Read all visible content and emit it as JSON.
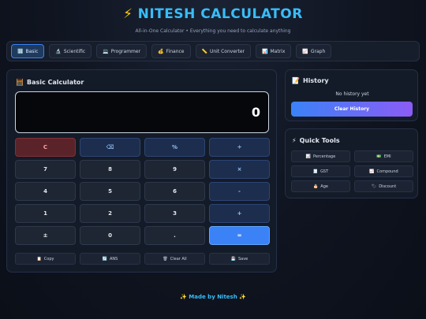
{
  "header": {
    "icon": "⚡",
    "title": "NITESH CALCULATOR",
    "subtitle": "All-in-One Calculator • Everything you need to calculate anything"
  },
  "tabs": [
    {
      "icon": "🔢",
      "label": "Basic",
      "active": true
    },
    {
      "icon": "🔬",
      "label": "Scientific"
    },
    {
      "icon": "💻",
      "label": "Programmer"
    },
    {
      "icon": "💰",
      "label": "Finance"
    },
    {
      "icon": "📏",
      "label": "Unit Converter"
    },
    {
      "icon": "📊",
      "label": "Matrix"
    },
    {
      "icon": "📈",
      "label": "Graph"
    }
  ],
  "calculator": {
    "icon": "🧮",
    "title": "Basic Calculator",
    "display": "0",
    "keys": [
      {
        "label": "C",
        "type": "clear"
      },
      {
        "label": "⌫",
        "type": "op"
      },
      {
        "label": "%",
        "type": "op"
      },
      {
        "label": "÷",
        "type": "op"
      },
      {
        "label": "7"
      },
      {
        "label": "8"
      },
      {
        "label": "9"
      },
      {
        "label": "×",
        "type": "op"
      },
      {
        "label": "4"
      },
      {
        "label": "5"
      },
      {
        "label": "6"
      },
      {
        "label": "-",
        "type": "op"
      },
      {
        "label": "1"
      },
      {
        "label": "2"
      },
      {
        "label": "3"
      },
      {
        "label": "+",
        "type": "op"
      },
      {
        "label": "±"
      },
      {
        "label": "0"
      },
      {
        "label": "."
      },
      {
        "label": "=",
        "type": "equal"
      }
    ],
    "actions": [
      {
        "icon": "📋",
        "label": "Copy"
      },
      {
        "icon": "🔄",
        "label": "ANS"
      },
      {
        "icon": "🗑",
        "label": "Clear All"
      },
      {
        "icon": "💾",
        "label": "Save"
      }
    ]
  },
  "history": {
    "icon": "📝",
    "title": "History",
    "empty_text": "No history yet",
    "clear_label": "Clear History"
  },
  "quick_tools": {
    "icon": "⚡",
    "title": "Quick Tools",
    "items": [
      {
        "icon": "📊",
        "label": "Percentage"
      },
      {
        "icon": "💵",
        "label": "EMI"
      },
      {
        "icon": "🧾",
        "label": "GST"
      },
      {
        "icon": "📈",
        "label": "Compound"
      },
      {
        "icon": "🎂",
        "label": "Age"
      },
      {
        "icon": "🏷",
        "label": "Discount"
      }
    ]
  },
  "footer": "✨ Made by Nitesh ✨"
}
